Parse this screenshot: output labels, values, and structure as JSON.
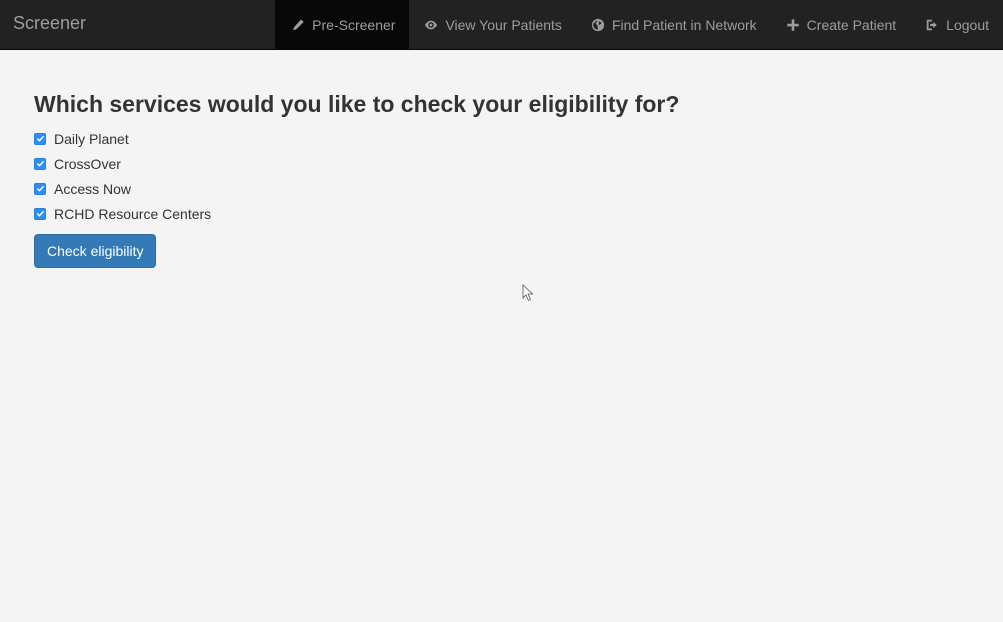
{
  "navbar": {
    "brand": "Screener",
    "items": [
      {
        "label": "Pre-Screener",
        "icon": "pencil-icon",
        "active": true
      },
      {
        "label": "View Your Patients",
        "icon": "eye-icon"
      },
      {
        "label": "Find Patient in Network",
        "icon": "globe-icon"
      },
      {
        "label": "Create Patient",
        "icon": "plus-icon"
      },
      {
        "label": "Logout",
        "icon": "logout-icon"
      }
    ]
  },
  "main": {
    "heading": "Which services would you like to check your eligibility for?",
    "services": [
      {
        "label": "Daily Planet",
        "checked": true
      },
      {
        "label": "CrossOver",
        "checked": true
      },
      {
        "label": "Access Now",
        "checked": true
      },
      {
        "label": "RCHD Resource Centers",
        "checked": true
      }
    ],
    "submit_label": "Check eligibility"
  },
  "colors": {
    "navbar_bg": "#222222",
    "accent": "#337ab7",
    "checkbox": "#2d8ef3",
    "page_bg": "#f4f4f4"
  }
}
